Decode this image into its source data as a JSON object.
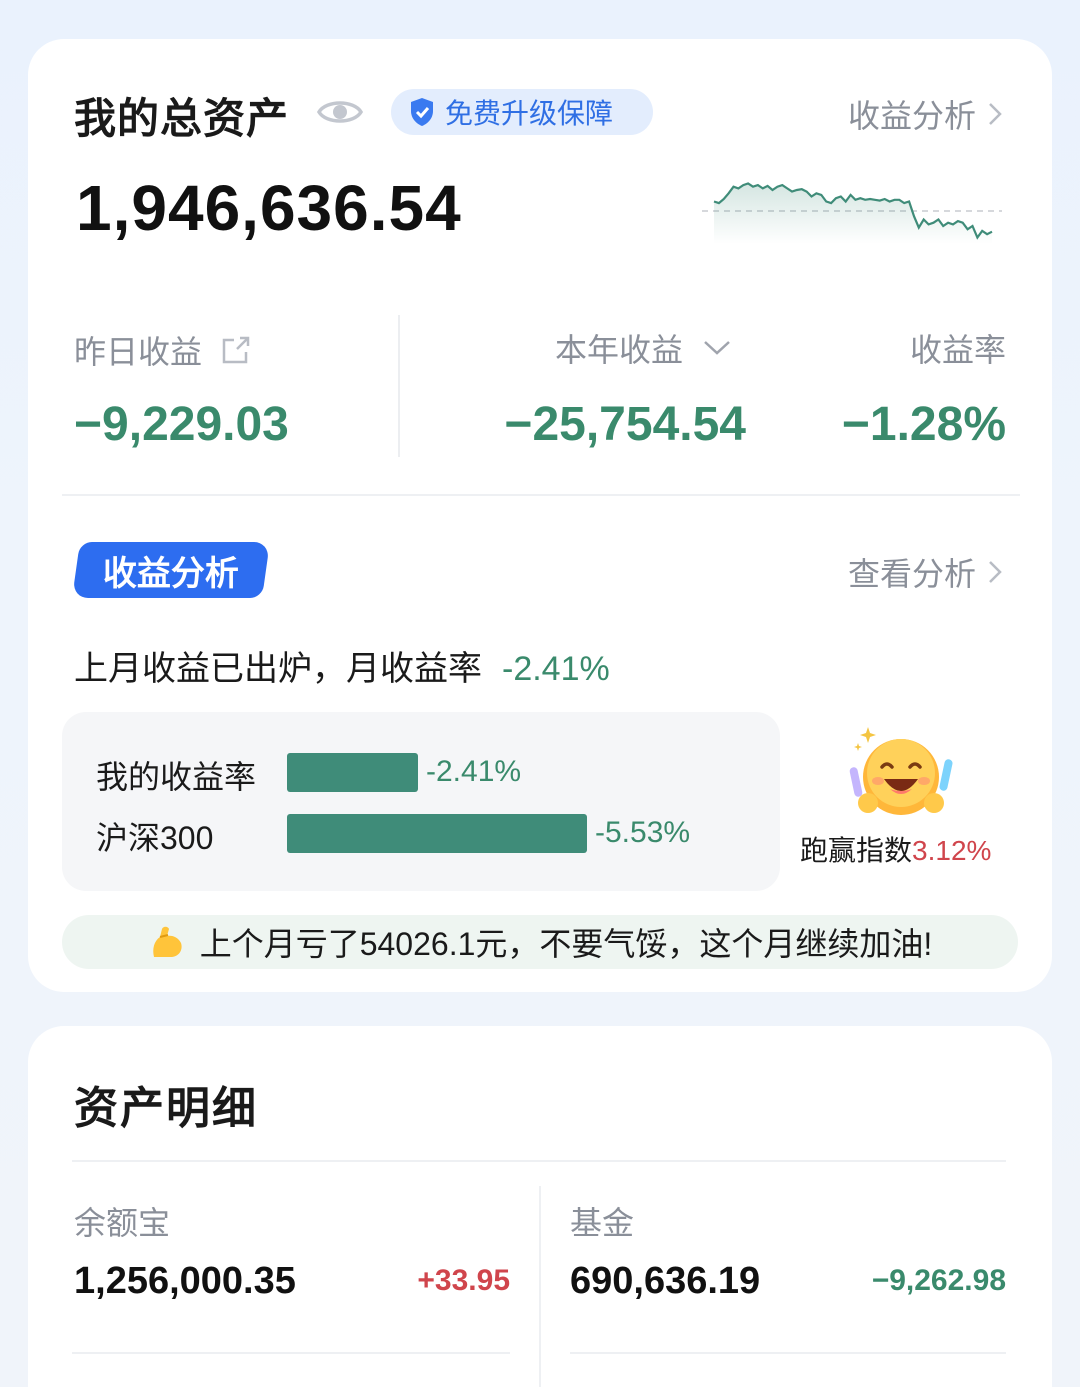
{
  "summary": {
    "title": "我的总资产",
    "badge": "免费升级保障",
    "analysis_link": "收益分析",
    "total_assets": "1,946,636.54",
    "yesterday_label": "昨日收益",
    "yesterday_value": "−9,229.03",
    "year_label": "本年收益",
    "year_value": "−25,754.54",
    "rate_label": "收益率",
    "rate_value": "−1.28%",
    "sparkline": [
      58,
      60,
      55,
      48,
      40,
      42,
      38,
      36,
      40,
      38,
      42,
      39,
      44,
      40,
      38,
      42,
      46,
      44,
      43,
      46,
      52,
      48,
      50,
      58,
      60,
      54,
      52,
      58,
      50,
      56,
      54,
      56,
      55,
      56,
      57,
      55,
      58,
      56,
      56,
      60,
      58,
      76,
      90,
      80,
      86,
      84,
      80,
      88,
      84,
      86,
      82,
      84,
      92,
      88,
      102,
      94,
      98,
      95
    ]
  },
  "analysis": {
    "tag": "收益分析",
    "view_link": "查看分析",
    "message": "上月收益已出炉，月收益率",
    "message_rate": "-2.41%",
    "compare": [
      {
        "label": "我的收益率",
        "value": "-2.41%",
        "rate": 2.41
      },
      {
        "label": "沪深300",
        "value": "-5.53%",
        "rate": 5.53
      }
    ],
    "beat_label": "跑赢指数",
    "beat_value": "3.12%",
    "encourage": "上个月亏了54026.1元，不要气馁，这个月继续加油!"
  },
  "details": {
    "title": "资产明细",
    "items": [
      {
        "name": "余额宝",
        "value": "1,256,000.35",
        "change": "+33.95",
        "color": "#d0454c"
      },
      {
        "name": "基金",
        "value": "690,636.19",
        "change": "−9,262.98",
        "color": "#3a8a6c"
      }
    ]
  },
  "colors": {
    "accent_blue": "#2d6df0",
    "loss_green": "#3a8a6c",
    "gain_red": "#d0454c",
    "bar_green": "#3f8c79"
  }
}
